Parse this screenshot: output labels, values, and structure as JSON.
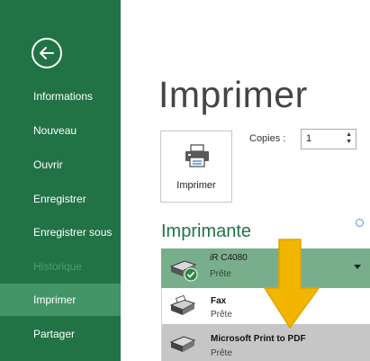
{
  "sidebar": {
    "back_icon": "back-arrow-icon",
    "items": [
      {
        "label": "Informations",
        "state": "normal"
      },
      {
        "label": "Nouveau",
        "state": "normal"
      },
      {
        "label": "Ouvrir",
        "state": "normal"
      },
      {
        "label": "Enregistrer",
        "state": "normal"
      },
      {
        "label": "Enregistrer sous",
        "state": "normal"
      },
      {
        "label": "Historique",
        "state": "disabled"
      },
      {
        "label": "Imprimer",
        "state": "active"
      },
      {
        "label": "Partager",
        "state": "normal"
      }
    ]
  },
  "main": {
    "title": "Imprimer",
    "print_button": {
      "label": "Imprimer",
      "icon": "printer-icon"
    },
    "copies": {
      "label": "Copies :",
      "value": "1"
    },
    "printer_section": {
      "title": "Imprimante",
      "info_icon": "info-icon",
      "selected": {
        "name": "iR C4080",
        "status": "Prête",
        "icon": "printer-ready-icon"
      },
      "options": [
        {
          "name": "Fax",
          "status": "Prête",
          "icon": "fax-icon"
        },
        {
          "name": "Microsoft Print to PDF",
          "status": "Prête",
          "icon": "pdf-printer-icon"
        }
      ]
    }
  },
  "colors": {
    "sidebar_bg": "#217346",
    "sidebar_active": "#439467",
    "accent": "#217346",
    "selected_printer_bg": "#79ae8c",
    "hover_bg": "#c6c6c6",
    "annotation_arrow": "#f2b500"
  }
}
